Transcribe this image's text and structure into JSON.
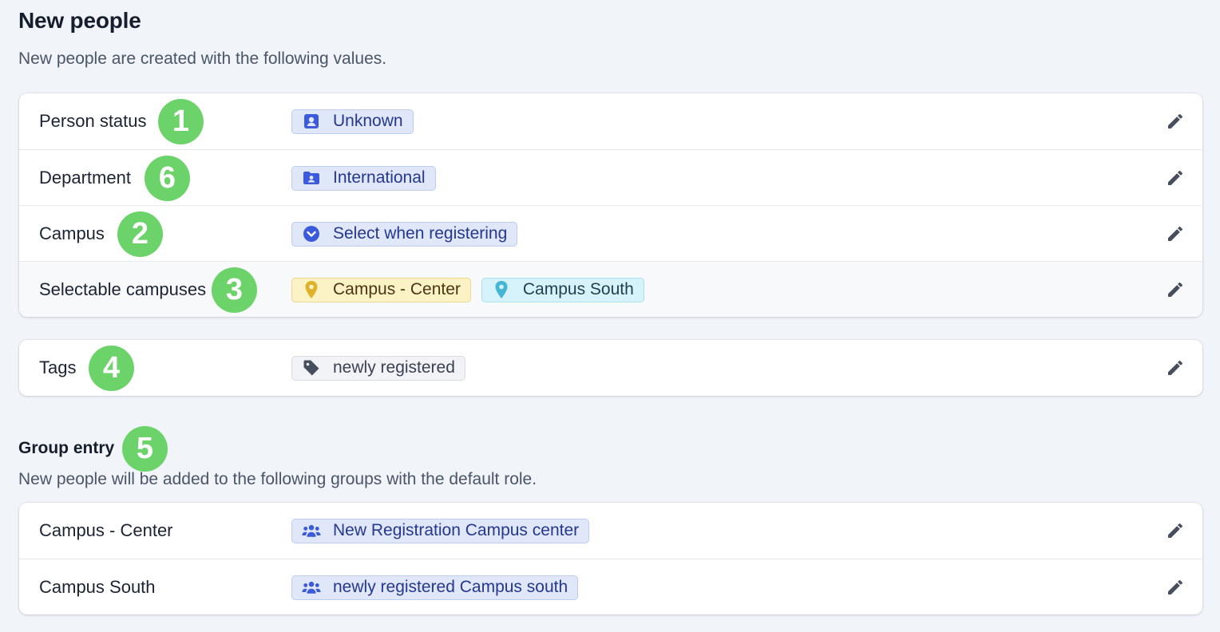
{
  "title": "New people",
  "subtitle": "New people are created with the following values.",
  "fields": [
    {
      "label": "Person status",
      "badge": "1",
      "tags": [
        {
          "text": "Unknown",
          "style": "blue",
          "icon": "contact-card-icon"
        }
      ]
    },
    {
      "label": "Department",
      "badge": "6",
      "tags": [
        {
          "text": "International",
          "style": "blue",
          "icon": "folder-user-icon"
        }
      ]
    },
    {
      "label": "Campus",
      "badge": "2",
      "tags": [
        {
          "text": "Select when registering",
          "style": "blue",
          "icon": "chevron-circle-icon"
        }
      ]
    },
    {
      "label": "Selectable campuses",
      "badge": "3",
      "tags": [
        {
          "text": "Campus - Center",
          "style": "yellow",
          "icon": "map-pin-icon",
          "color": "#e0b22b"
        },
        {
          "text": "Campus South",
          "style": "teal",
          "icon": "map-pin-icon",
          "color": "#45b5d6"
        }
      ]
    }
  ],
  "tags_section": {
    "label": "Tags",
    "badge": "4",
    "tags": [
      {
        "text": "newly registered",
        "style": "gray",
        "icon": "tag-icon"
      }
    ]
  },
  "group_entry": {
    "title": "Group entry",
    "badge": "5",
    "subtitle": "New people will be added to the following groups with the default role.",
    "rows": [
      {
        "label": "Campus - Center",
        "tag": "New Registration Campus center",
        "icon": "users-icon"
      },
      {
        "label": "Campus South",
        "tag": "newly registered Campus south",
        "icon": "users-icon"
      }
    ]
  },
  "colors": {
    "accent": "#3b5bdb",
    "badge_green": "#6cd36a",
    "edit_icon": "#474f5e"
  }
}
